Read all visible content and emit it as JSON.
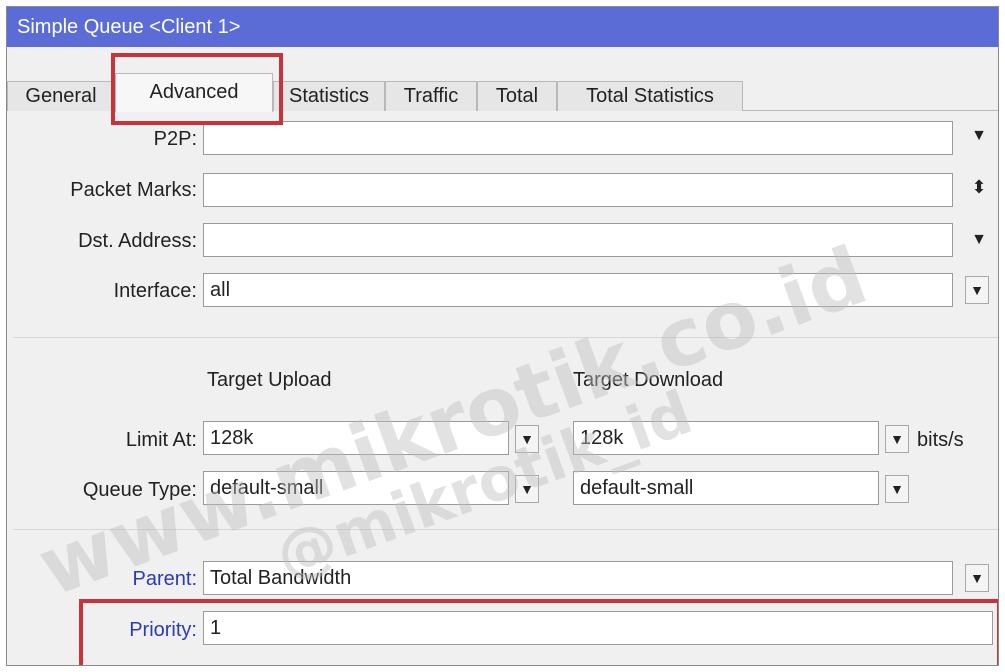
{
  "window": {
    "title": "Simple Queue <Client 1>"
  },
  "tabs": [
    {
      "label": "General"
    },
    {
      "label": "Advanced"
    },
    {
      "label": "Statistics"
    },
    {
      "label": "Traffic"
    },
    {
      "label": "Total"
    },
    {
      "label": "Total Statistics"
    }
  ],
  "fields": {
    "p2p": {
      "label": "P2P:",
      "value": ""
    },
    "packet_marks": {
      "label": "Packet Marks:",
      "value": ""
    },
    "dst_address": {
      "label": "Dst. Address:",
      "value": ""
    },
    "interface": {
      "label": "Interface:",
      "value": "all"
    }
  },
  "targets": {
    "upload_header": "Target Upload",
    "download_header": "Target Download",
    "limit_at": {
      "label": "Limit At:",
      "upload": "128k",
      "download": "128k",
      "units": "bits/s"
    },
    "queue_type": {
      "label": "Queue Type:",
      "upload": "default-small",
      "download": "default-small"
    }
  },
  "parent": {
    "label": "Parent:",
    "value": "Total Bandwidth"
  },
  "priority": {
    "label": "Priority:",
    "value": "1"
  },
  "watermarks": [
    "www.mikrotik.co.id",
    "@mikrotik_id"
  ],
  "colors": {
    "titlebar": "#5b6cd6",
    "highlight": "#c8323a",
    "link_label": "#2a3bb8"
  }
}
